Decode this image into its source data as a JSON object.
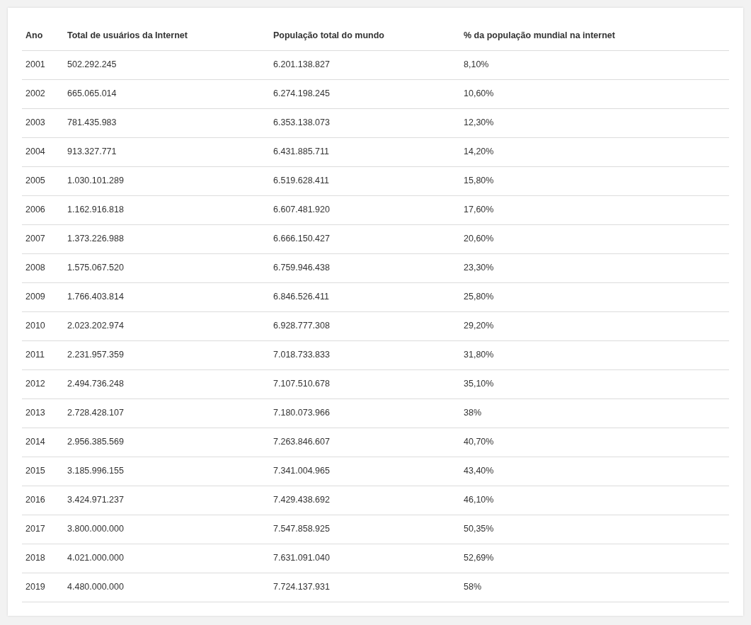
{
  "table": {
    "columns": [
      "Ano",
      "Total de usuários da Internet",
      "População total do mundo",
      "% da população mundial na internet"
    ],
    "rows": [
      [
        "2001",
        "502.292.245",
        "6.201.138.827",
        "8,10%"
      ],
      [
        "2002",
        "665.065.014",
        "6.274.198.245",
        "10,60%"
      ],
      [
        "2003",
        "781.435.983",
        "6.353.138.073",
        "12,30%"
      ],
      [
        "2004",
        "913.327.771",
        "6.431.885.711",
        "14,20%"
      ],
      [
        "2005",
        "1.030.101.289",
        "6.519.628.411",
        "15,80%"
      ],
      [
        "2006",
        "1.162.916.818",
        "6.607.481.920",
        "17,60%"
      ],
      [
        "2007",
        "1.373.226.988",
        "6.666.150.427",
        "20,60%"
      ],
      [
        "2008",
        "1.575.067.520",
        "6.759.946.438",
        "23,30%"
      ],
      [
        "2009",
        "1.766.403.814",
        "6.846.526.411",
        "25,80%"
      ],
      [
        "2010",
        "2.023.202.974",
        "6.928.777.308",
        "29,20%"
      ],
      [
        "2011",
        "2.231.957.359",
        "7.018.733.833",
        "31,80%"
      ],
      [
        "2012",
        "2.494.736.248",
        "7.107.510.678",
        "35,10%"
      ],
      [
        "2013",
        "2.728.428.107",
        "7.180.073.966",
        "38%"
      ],
      [
        "2014",
        "2.956.385.569",
        "7.263.846.607",
        "40,70%"
      ],
      [
        "2015",
        "3.185.996.155",
        "7.341.004.965",
        "43,40%"
      ],
      [
        "2016",
        "3.424.971.237",
        "7.429.438.692",
        "46,10%"
      ],
      [
        "2017",
        "3.800.000.000",
        "7.547.858.925",
        "50,35%"
      ],
      [
        "2018",
        "4.021.000.000",
        "7.631.091.040",
        "52,69%"
      ],
      [
        "2019",
        "4.480.000.000",
        "7.724.137.931",
        "58%"
      ]
    ]
  }
}
